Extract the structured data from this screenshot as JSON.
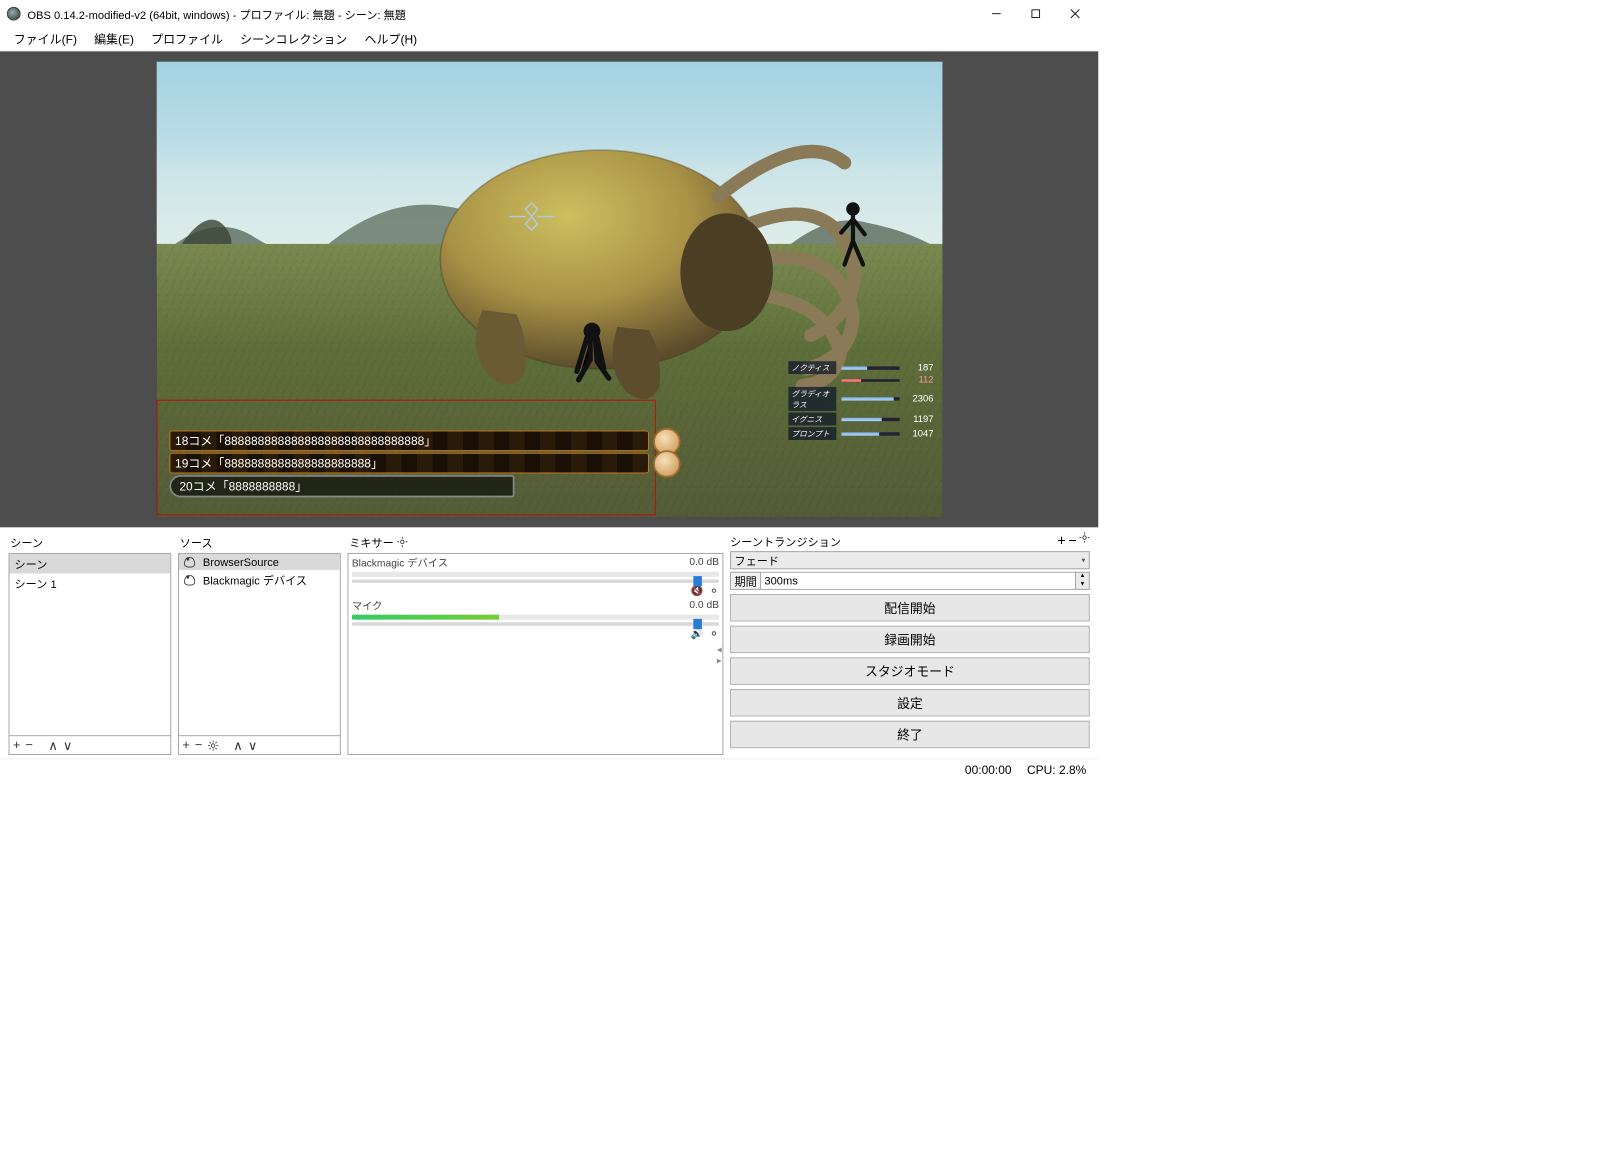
{
  "window": {
    "title": "OBS 0.14.2-modified-v2 (64bit, windows) - プロファイル: 無題 - シーン: 無題"
  },
  "menubar": {
    "items": [
      "ファイル(F)",
      "編集(E)",
      "プロファイル",
      "シーンコレクション",
      "ヘルプ(H)"
    ]
  },
  "preview": {
    "comments": [
      "18コメ「888888888888888888888888888888」",
      "19コメ「8888888888888888888888」",
      "20コメ「8888888888」"
    ],
    "hp": [
      {
        "name": "ノクティス",
        "val": "187",
        "mp": "112",
        "pct": 45
      },
      {
        "name": "グラディオラス",
        "val": "2306",
        "pct": 90
      },
      {
        "name": "イグニス",
        "val": "1197",
        "pct": 70
      },
      {
        "name": "プロンプト",
        "val": "1047",
        "pct": 65
      }
    ]
  },
  "scenes": {
    "label": "シーン",
    "header": "シーン",
    "items": [
      "シーン 1"
    ]
  },
  "sources": {
    "label": "ソース",
    "items": [
      "BrowserSource",
      "Blackmagic デバイス"
    ]
  },
  "mixer": {
    "label": "ミキサー",
    "channels": [
      {
        "name": "Blackmagic デバイス",
        "db": "0.0 dB",
        "level": 0,
        "thumb": 93,
        "muted": true
      },
      {
        "name": "マイク",
        "db": "0.0 dB",
        "level": 40,
        "thumb": 93,
        "muted": false
      }
    ]
  },
  "transitions": {
    "label": "シーントランジション",
    "selected": "フェード",
    "duration_label": "期間",
    "duration_value": "300ms"
  },
  "buttons": {
    "stream": "配信開始",
    "record": "録画開始",
    "studio": "スタジオモード",
    "settings": "設定",
    "exit": "終了"
  },
  "status": {
    "time": "00:00:00",
    "cpu": "CPU: 2.8%"
  }
}
